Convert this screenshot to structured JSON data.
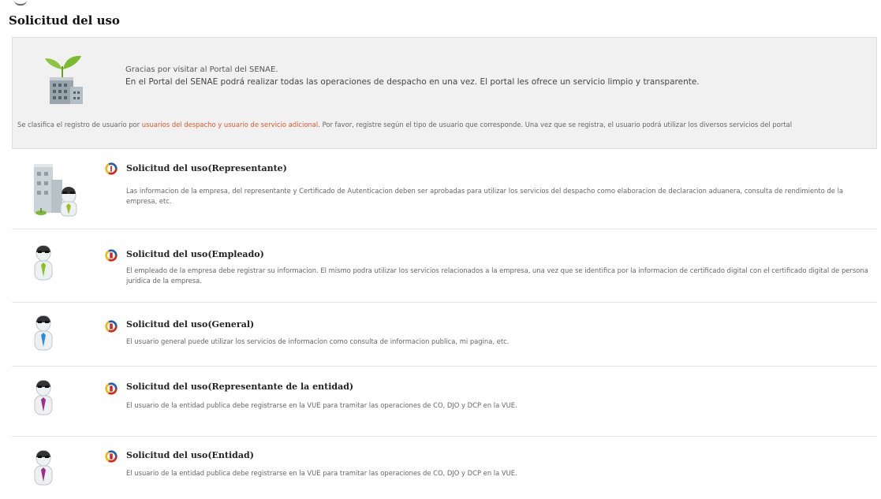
{
  "page": {
    "title": "Solicitud del uso"
  },
  "intro": {
    "greeting": "Gracias por visitar al Portal del SENAE.",
    "portal_text": "En el Portal del SENAE podrá realizar todas las operaciones de despacho en una vez. El portal les ofrece un servicio limpio y transparente.",
    "note_prefix": "Se clasifica el registro de usuario por ",
    "note_link": "usuarios del despacho y usuario de servicio adicional",
    "note_suffix": ". Por favor, registre según el tipo de usuario que corresponde. Una vez que se registra, el usuario podrá utilizar los diversos servicios del portal",
    "icon": "building-plant-icon"
  },
  "options": [
    {
      "title": "Solicitud del uso(Representante)",
      "description": "Las informacion de la empresa, del representante y Certificado de Autenticacion deben ser aprobadas para utilizar los servicios del despacho como elaboracion de declaracion aduanera, consulta de rendimiento de la empresa, etc.",
      "icon": "company-representative-icon",
      "tie_color": "#9bbf2a"
    },
    {
      "title": "Solicitud del uso(Empleado)",
      "description": "El empleado de la empresa debe registrar su informacion. El mismo podra utilizar los servicios relacionados a la empresa, una vez que se identifica por la informacion de certificado digital con el certificado digital de persona juridica de la empresa.",
      "icon": "employee-icon",
      "tie_color": "#8cbf26"
    },
    {
      "title": "Solicitud del uso(General)",
      "description": "El usuario general puede utilizar los servicios de informacion como consulta de informacion publica, mi pagina, etc.",
      "icon": "general-user-icon",
      "tie_color": "#2a8fd6"
    },
    {
      "title": "Solicitud del uso(Representante de la entidad)",
      "description": "El usuario de la entidad publica debe registrarse en la VUE para tramitar las operaciones de CO, DJO y DCP en la VUE.",
      "icon": "entity-representative-icon",
      "tie_color": "#9c2d8f"
    },
    {
      "title": "Solicitud del uso(Entidad)",
      "description": "El usuario de la entidad publica debe registrarse en la VUE para tramitar las operaciones de CO, DJO y DCP en la VUE.",
      "icon": "entity-user-icon",
      "tie_color": "#9c2d8f"
    }
  ],
  "colors": {
    "step_ring": [
      "#d42a1e",
      "#f2b515",
      "#1e5fb4"
    ],
    "link": "#e05a2b"
  }
}
